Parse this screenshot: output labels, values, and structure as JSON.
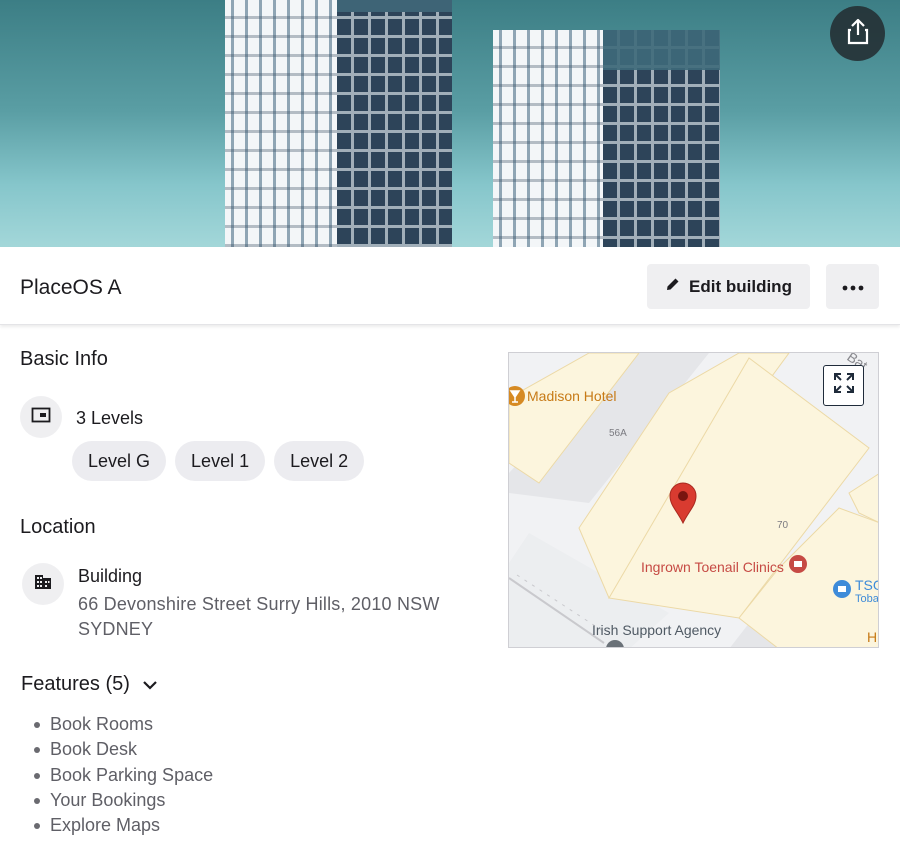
{
  "header": {
    "building_name": "PlaceOS A",
    "edit_label": "Edit building"
  },
  "basic_info": {
    "title": "Basic Info",
    "levels_count": "3 Levels",
    "levels": [
      "Level G",
      "Level 1",
      "Level 2"
    ]
  },
  "location": {
    "title": "Location",
    "building_label": "Building",
    "address": "66 Devonshire Street Surry Hills, 2010 NSW SYDNEY"
  },
  "features": {
    "title": "Features (5)",
    "items": [
      "Book Rooms",
      "Book Desk",
      "Book Parking Space",
      "Your Bookings",
      "Explore Maps"
    ]
  },
  "map": {
    "labels": {
      "madison_hotel": "Madison Hotel",
      "lot_56a": "56A",
      "lot_70": "70",
      "ingrown": "Ingrown Toenail Clinics",
      "irish": "Irish Support Agency",
      "tsg": "TSG",
      "toba": "Toba",
      "street_partial": "Bat",
      "he_partial": "H"
    }
  },
  "colors": {
    "pin": "#d93b30",
    "poi_orange": "#d68a23",
    "poi_red": "#c64a44",
    "poi_blue": "#3e8bd9",
    "chip_bg": "#ececf0"
  },
  "icons": {
    "share": "share-icon",
    "edit": "pencil-icon",
    "more": "more-horizontal-icon",
    "levels": "levels-icon",
    "building": "building-icon",
    "expand": "expand-icon",
    "chevron": "chevron-down-icon",
    "pin": "map-pin-icon"
  }
}
